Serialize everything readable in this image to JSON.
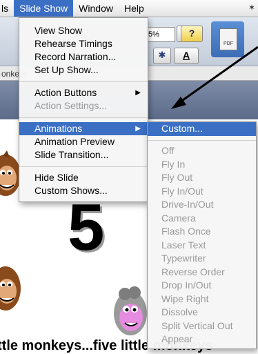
{
  "menubar": {
    "items": [
      {
        "label": "ls",
        "active": false
      },
      {
        "label": "Slide Show",
        "active": true
      },
      {
        "label": "Window",
        "active": false
      },
      {
        "label": "Help",
        "active": false
      }
    ]
  },
  "toolbar": {
    "zoom_value": "5%",
    "pdf_label": "PDF"
  },
  "tab_text": "onkeys",
  "slide_show_menu": {
    "items": [
      {
        "label": "View Show",
        "enabled": true
      },
      {
        "label": "Rehearse Timings",
        "enabled": true
      },
      {
        "label": "Record Narration...",
        "enabled": true
      },
      {
        "label": "Set Up Show...",
        "enabled": true
      },
      {
        "label": "Action Buttons",
        "enabled": true,
        "submenu": true
      },
      {
        "label": "Action Settings...",
        "enabled": false
      },
      {
        "label": "Animations",
        "enabled": true,
        "submenu": true,
        "highlighted": true
      },
      {
        "label": "Animation Preview",
        "enabled": true
      },
      {
        "label": "Slide Transition...",
        "enabled": true
      },
      {
        "label": "Hide Slide",
        "enabled": true
      },
      {
        "label": "Custom Shows...",
        "enabled": true
      }
    ]
  },
  "animations_submenu": {
    "items": [
      {
        "label": "Custom...",
        "enabled": true,
        "highlighted": true
      },
      {
        "label": "Off",
        "enabled": false
      },
      {
        "label": "Fly In",
        "enabled": false
      },
      {
        "label": "Fly Out",
        "enabled": false
      },
      {
        "label": "Fly In/Out",
        "enabled": false
      },
      {
        "label": "Drive-In/Out",
        "enabled": false
      },
      {
        "label": "Camera",
        "enabled": false
      },
      {
        "label": "Flash Once",
        "enabled": false
      },
      {
        "label": "Laser Text",
        "enabled": false
      },
      {
        "label": "Typewriter",
        "enabled": false
      },
      {
        "label": "Reverse Order",
        "enabled": false
      },
      {
        "label": "Drop In/Out",
        "enabled": false
      },
      {
        "label": "Wipe Right",
        "enabled": false
      },
      {
        "label": "Dissolve",
        "enabled": false
      },
      {
        "label": "Split Vertical Out",
        "enabled": false
      },
      {
        "label": "Appear",
        "enabled": false
      }
    ]
  },
  "slide": {
    "number_text": "5",
    "caption": "ttle monkeys...five little monkeys"
  },
  "colors": {
    "highlight": "#3b6fc4",
    "disabled_text": "#9a9a9a",
    "slide_header": "#6a7996"
  }
}
